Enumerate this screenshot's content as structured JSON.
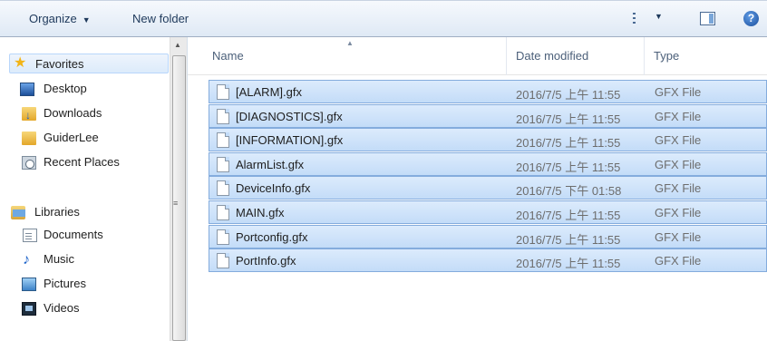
{
  "toolbar": {
    "organize_label": "Organize",
    "new_folder_label": "New folder",
    "help_label": "?"
  },
  "nav": {
    "favorites": {
      "label": "Favorites",
      "items": [
        {
          "label": "Desktop",
          "icon": "desktop-icon"
        },
        {
          "label": "Downloads",
          "icon": "downloads-folder-icon"
        },
        {
          "label": "GuiderLee",
          "icon": "folder-icon"
        },
        {
          "label": "Recent Places",
          "icon": "recent-places-icon"
        }
      ]
    },
    "libraries": {
      "label": "Libraries",
      "items": [
        {
          "label": "Documents",
          "icon": "documents-icon"
        },
        {
          "label": "Music",
          "icon": "music-icon"
        },
        {
          "label": "Pictures",
          "icon": "pictures-icon"
        },
        {
          "label": "Videos",
          "icon": "videos-icon"
        }
      ]
    }
  },
  "columns": {
    "name": "Name",
    "date": "Date modified",
    "type": "Type"
  },
  "files": [
    {
      "name": "[ALARM].gfx",
      "date": "2016/7/5 上午 11:55",
      "type": "GFX File"
    },
    {
      "name": "[DIAGNOSTICS].gfx",
      "date": "2016/7/5 上午 11:55",
      "type": "GFX File"
    },
    {
      "name": "[INFORMATION].gfx",
      "date": "2016/7/5 上午 11:55",
      "type": "GFX File"
    },
    {
      "name": "AlarmList.gfx",
      "date": "2016/7/5 上午 11:55",
      "type": "GFX File"
    },
    {
      "name": "DeviceInfo.gfx",
      "date": "2016/7/5 下午 01:58",
      "type": "GFX File"
    },
    {
      "name": "MAIN.gfx",
      "date": "2016/7/5 上午 11:55",
      "type": "GFX File"
    },
    {
      "name": "Portconfig.gfx",
      "date": "2016/7/5 上午 11:55",
      "type": "GFX File"
    },
    {
      "name": "PortInfo.gfx",
      "date": "2016/7/5 上午 11:55",
      "type": "GFX File"
    }
  ],
  "colors": {
    "selection": "#cce4fb",
    "selection_border": "#84acdd",
    "toolbar_text": "#1e395b"
  }
}
